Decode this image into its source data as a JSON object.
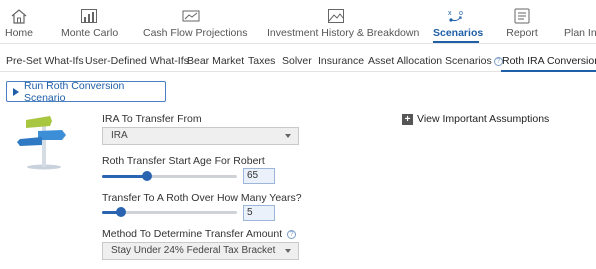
{
  "nav": {
    "items": [
      {
        "label": "Home",
        "icon": "home-icon"
      },
      {
        "label": "Monte Carlo",
        "icon": "bar-chart-icon"
      },
      {
        "label": "Cash Flow Projections",
        "icon": "cash-flow-icon"
      },
      {
        "label": "Investment History & Breakdown",
        "icon": "image-chart-icon"
      },
      {
        "label": "Scenarios",
        "icon": "scenarios-icon",
        "active": true
      },
      {
        "label": "Report",
        "icon": "report-icon"
      },
      {
        "label": "Plan In",
        "icon": ""
      }
    ]
  },
  "subtabs": {
    "items": [
      {
        "label": "Pre-Set What-Ifs"
      },
      {
        "label": "User-Defined What-Ifs"
      },
      {
        "label": "Bear Market"
      },
      {
        "label": "Taxes"
      },
      {
        "label": "Solver"
      },
      {
        "label": "Insurance"
      },
      {
        "label": "Asset Allocation Scenarios",
        "help": true
      },
      {
        "label": "Roth IRA Conversion",
        "active": true
      }
    ]
  },
  "run_button": {
    "label": "Run Roth Conversion Scenario"
  },
  "assumptions": {
    "label": "View Important Assumptions",
    "icon": "plus-icon"
  },
  "form": {
    "ira_from": {
      "label": "IRA To Transfer From",
      "value": "IRA"
    },
    "start_age": {
      "label": "Roth Transfer Start Age For Robert",
      "value": "65",
      "slider_fraction": 0.33
    },
    "years": {
      "label": "Transfer To A Roth Over How Many Years?",
      "value": "5",
      "slider_fraction": 0.14
    },
    "method": {
      "label": "Method To Determine Transfer Amount",
      "value": "Stay Under 24% Federal Tax Bracket",
      "help": true
    }
  },
  "colors": {
    "accent": "#1f5fa8",
    "slider": "#2a64b0"
  }
}
